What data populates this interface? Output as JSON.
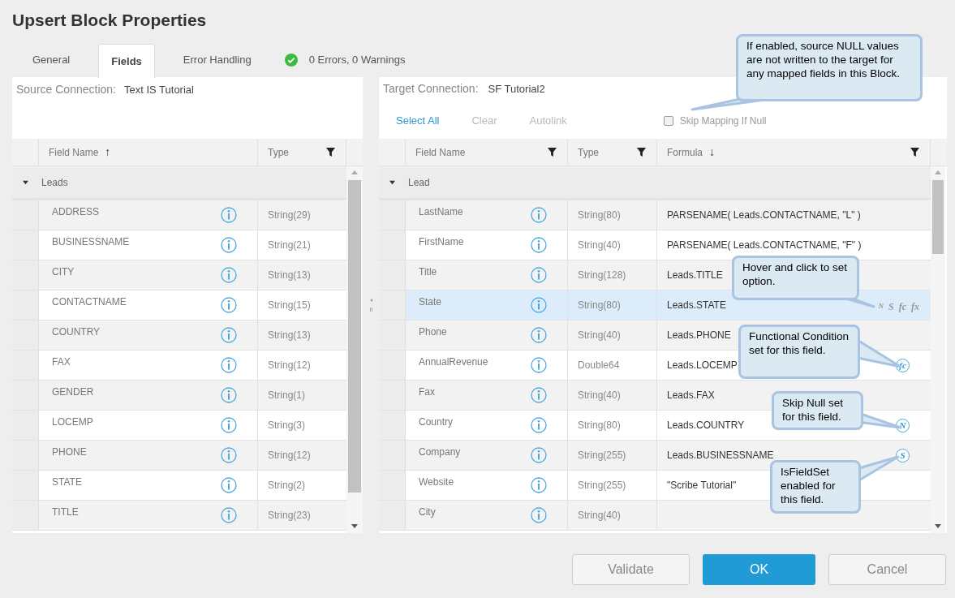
{
  "window": {
    "title": "Upsert Block Properties"
  },
  "tabs": [
    {
      "label": "General",
      "selected": false
    },
    {
      "label": "Fields",
      "selected": true
    },
    {
      "label": "Error Handling",
      "selected": false
    }
  ],
  "validation_status": {
    "ok": true,
    "text": "0 Errors, 0 Warnings"
  },
  "source": {
    "label": "Source Connection:",
    "value": "Text IS Tutorial",
    "columns": [
      {
        "label": "Field Name",
        "sort_arrow": "↑",
        "filter": false
      },
      {
        "label": "Type",
        "filter": true
      }
    ],
    "group": {
      "label": "Leads",
      "expanded": true
    },
    "rows": [
      {
        "name": "ADDRESS",
        "type": "String(29)"
      },
      {
        "name": "BUSINESSNAME",
        "type": "String(21)"
      },
      {
        "name": "CITY",
        "type": "String(13)"
      },
      {
        "name": "CONTACTNAME",
        "type": "String(15)"
      },
      {
        "name": "COUNTRY",
        "type": "String(13)"
      },
      {
        "name": "FAX",
        "type": "String(12)"
      },
      {
        "name": "GENDER",
        "type": "String(1)"
      },
      {
        "name": "LOCEMP",
        "type": "String(3)"
      },
      {
        "name": "PHONE",
        "type": "String(12)"
      },
      {
        "name": "STATE",
        "type": "String(2)"
      },
      {
        "name": "TITLE",
        "type": "String(23)"
      }
    ]
  },
  "target": {
    "label": "Target Connection:",
    "value": "SF Tutorial2",
    "toolbar": [
      {
        "label": "Select All",
        "disabled": false
      },
      {
        "label": "Clear",
        "disabled": true
      },
      {
        "label": "Autolink",
        "disabled": true
      }
    ],
    "skip_mapping": {
      "label": "Skip Mapping If Null",
      "checked": false
    },
    "columns": [
      {
        "label": "Field Name",
        "filter": true
      },
      {
        "label": "Type",
        "filter": true
      },
      {
        "label": "Formula",
        "sort_arrow": "↓",
        "filter": true
      }
    ],
    "group": {
      "label": "Lead",
      "expanded": true
    },
    "rows": [
      {
        "name": "LastName",
        "type": "String(80)",
        "formula": "PARSENAME( Leads.CONTACTNAME, \"L\" )",
        "selected": false
      },
      {
        "name": "FirstName",
        "type": "String(40)",
        "formula": "PARSENAME( Leads.CONTACTNAME, \"F\" )",
        "selected": false
      },
      {
        "name": "Title",
        "type": "String(128)",
        "formula": "Leads.TITLE",
        "selected": false
      },
      {
        "name": "State",
        "type": "String(80)",
        "formula": "Leads.STATE",
        "selected": true,
        "option_icons": [
          "N",
          "S",
          "fc",
          "fx"
        ]
      },
      {
        "name": "Phone",
        "type": "String(40)",
        "formula": "Leads.PHONE",
        "selected": false
      },
      {
        "name": "AnnualRevenue",
        "type": "Double64",
        "formula": "Leads.LOCEMP",
        "selected": false,
        "marker": "fc"
      },
      {
        "name": "Fax",
        "type": "String(40)",
        "formula": "Leads.FAX",
        "selected": false
      },
      {
        "name": "Country",
        "type": "String(80)",
        "formula": "Leads.COUNTRY",
        "selected": false,
        "marker": "N"
      },
      {
        "name": "Company",
        "type": "String(255)",
        "formula": "Leads.BUSINESSNAME",
        "selected": false,
        "marker": "S"
      },
      {
        "name": "Website",
        "type": "String(255)",
        "formula": "\"Scribe Tutorial\"",
        "selected": false
      },
      {
        "name": "City",
        "type": "String(40)",
        "formula": "",
        "selected": false
      }
    ]
  },
  "callouts": [
    "If enabled, source NULL values are not written to the target for any mapped fields in this Block.",
    "Hover and click to set option.",
    "Functional Condition set for this field.",
    "Skip Null set for this field.",
    "IsFieldSet enabled for this field."
  ],
  "buttons": [
    {
      "label": "Validate",
      "kind": "secondary"
    },
    {
      "label": "OK",
      "kind": "primary"
    },
    {
      "label": "Cancel",
      "kind": "secondary"
    }
  ]
}
